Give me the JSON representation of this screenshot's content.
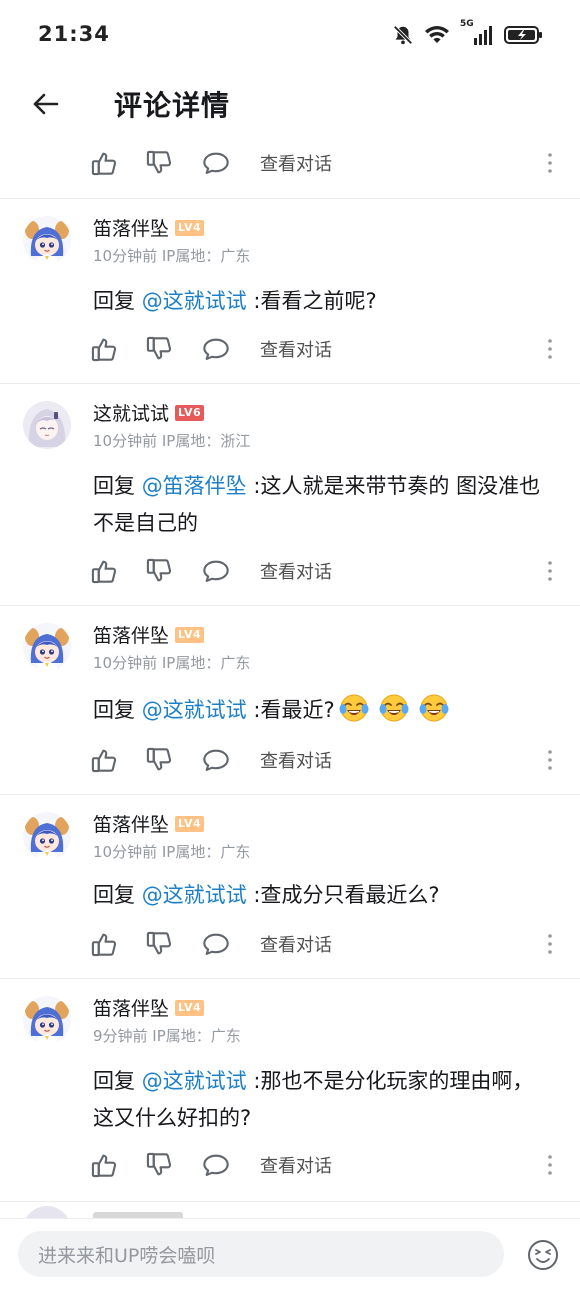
{
  "status_bar": {
    "time": "21:34",
    "network_label": "5G"
  },
  "header": {
    "title": "评论详情"
  },
  "actions": {
    "view_dialog": "查看对话"
  },
  "comments": [
    {
      "username": "笛落伴坠",
      "level": "LV4",
      "meta": "10分钟前 IP属地：广东",
      "prefix": "回复 ",
      "mention": "@这就试试",
      "text": " :看看之前呢?"
    },
    {
      "username": "这就试试",
      "level": "LV6",
      "meta": "10分钟前 IP属地：浙江",
      "prefix": "回复 ",
      "mention": "@笛落伴坠",
      "text": " :这人就是来带节奏的 图没准也不是自己的"
    },
    {
      "username": "笛落伴坠",
      "level": "LV4",
      "meta": "10分钟前 IP属地：广东",
      "prefix": "回复 ",
      "mention": "@这就试试",
      "text": " :看最近?"
    },
    {
      "username": "笛落伴坠",
      "level": "LV4",
      "meta": "10分钟前 IP属地：广东",
      "prefix": "回复 ",
      "mention": "@这就试试",
      "text": " :查成分只看最近么?"
    },
    {
      "username": "笛落伴坠",
      "level": "LV4",
      "meta": "9分钟前 IP属地：广东",
      "prefix": "回复 ",
      "mention": "@这就试试",
      "text": " :那也不是分化玩家的理由啊，这又什么好扣的?"
    }
  ],
  "bottom_bar": {
    "input_placeholder": "进来来和UP唠会嗑呗"
  },
  "icons": {
    "back": "arrow-left-icon",
    "like": "thumbs-up-icon",
    "dislike": "thumbs-down-icon",
    "reply": "speech-bubble-icon",
    "more": "more-vertical-icon",
    "emoji": "emoji-face-icon",
    "crying_laughing": "crying-laughing-emoji-icon"
  },
  "colors": {
    "mention": "#1c7fc8",
    "lv4": "#ffc184",
    "lv6": "#e65a5a",
    "meta": "#9499a0"
  }
}
